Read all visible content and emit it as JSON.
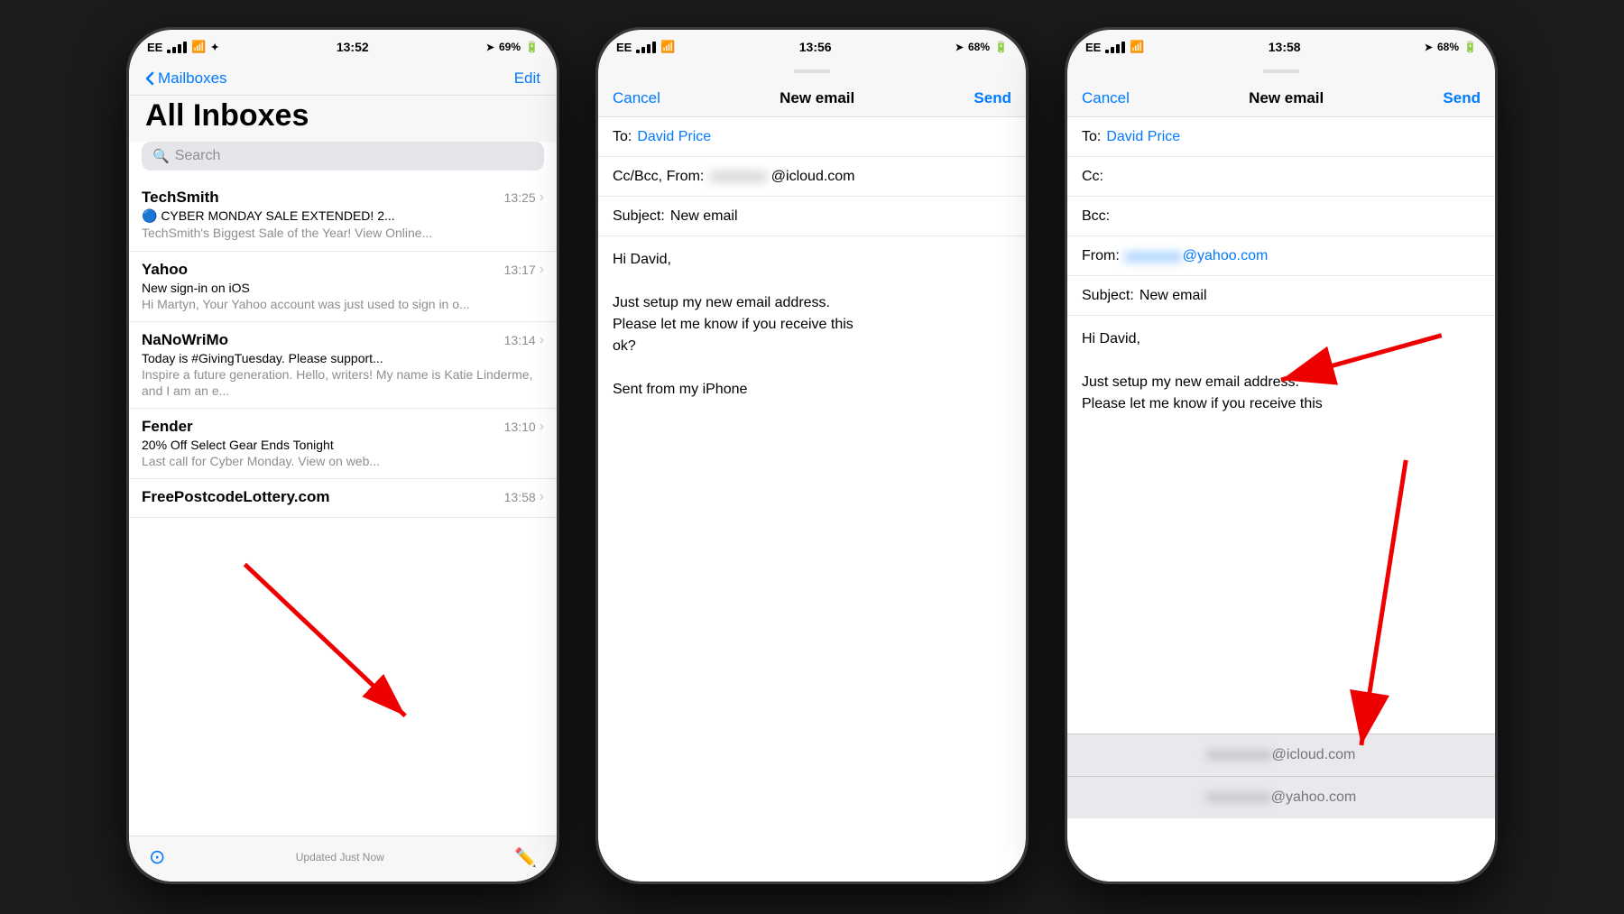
{
  "screens": [
    {
      "id": "screen1",
      "status": {
        "carrier": "EE",
        "time": "13:52",
        "battery": "69%",
        "wifi": true,
        "location": true
      },
      "nav": {
        "back_label": "Mailboxes",
        "edit_label": "Edit"
      },
      "title": "All Inboxes",
      "search_placeholder": "Search",
      "emails": [
        {
          "sender": "TechSmith",
          "time": "13:25",
          "subject": "🔵 CYBER MONDAY SALE EXTENDED! 2...",
          "preview": "TechSmith's Biggest Sale of the Year! View Online..."
        },
        {
          "sender": "Yahoo",
          "time": "13:17",
          "subject": "New sign-in on iOS",
          "preview": "Hi Martyn, Your Yahoo account was just used to sign in o..."
        },
        {
          "sender": "NaNoWriMo",
          "time": "13:14",
          "subject": "Today is #GivingTuesday. Please support...",
          "preview": "Inspire a future generation. Hello, writers! My name is Katie Linderme, and I am an e..."
        },
        {
          "sender": "Fender",
          "time": "13:10",
          "subject": "20% Off Select Gear Ends Tonight",
          "preview": "Last call for Cyber Monday. View on web..."
        },
        {
          "sender": "FreePostcodeLottery.com",
          "time": "13:58",
          "subject": "",
          "preview": ""
        }
      ],
      "tab_bar": {
        "updated": "Updated Just Now"
      }
    },
    {
      "id": "screen2",
      "status": {
        "carrier": "EE",
        "time": "13:56",
        "battery": "68%",
        "wifi": true,
        "location": true
      },
      "compose": {
        "cancel": "Cancel",
        "title": "New email",
        "send": "Send",
        "to_label": "To:",
        "to_value": "David Price",
        "cc_label": "Cc/Bcc, From:",
        "cc_value": "@icloud.com",
        "subject_label": "Subject:",
        "subject_value": "New email",
        "body": "Hi David,\n\nJust setup my new email address.\nPlease let me know if you receive this\nok?\n\nSent from my iPhone"
      }
    },
    {
      "id": "screen3",
      "status": {
        "carrier": "EE",
        "time": "13:58",
        "battery": "68%",
        "wifi": true,
        "location": true
      },
      "compose": {
        "cancel": "Cancel",
        "title": "New email",
        "send": "Send",
        "to_label": "To:",
        "to_value": "David Price",
        "cc_label": "Cc:",
        "bcc_label": "Bcc:",
        "from_label": "From:",
        "from_value": "@yahoo.com",
        "subject_label": "Subject:",
        "subject_value": "New email",
        "body": "Hi David,\n\nJust setup my new email address.\nPlease let me know if you receive this"
      },
      "dropdown": {
        "items": [
          "@icloud.com",
          "@yahoo.com"
        ]
      }
    }
  ]
}
